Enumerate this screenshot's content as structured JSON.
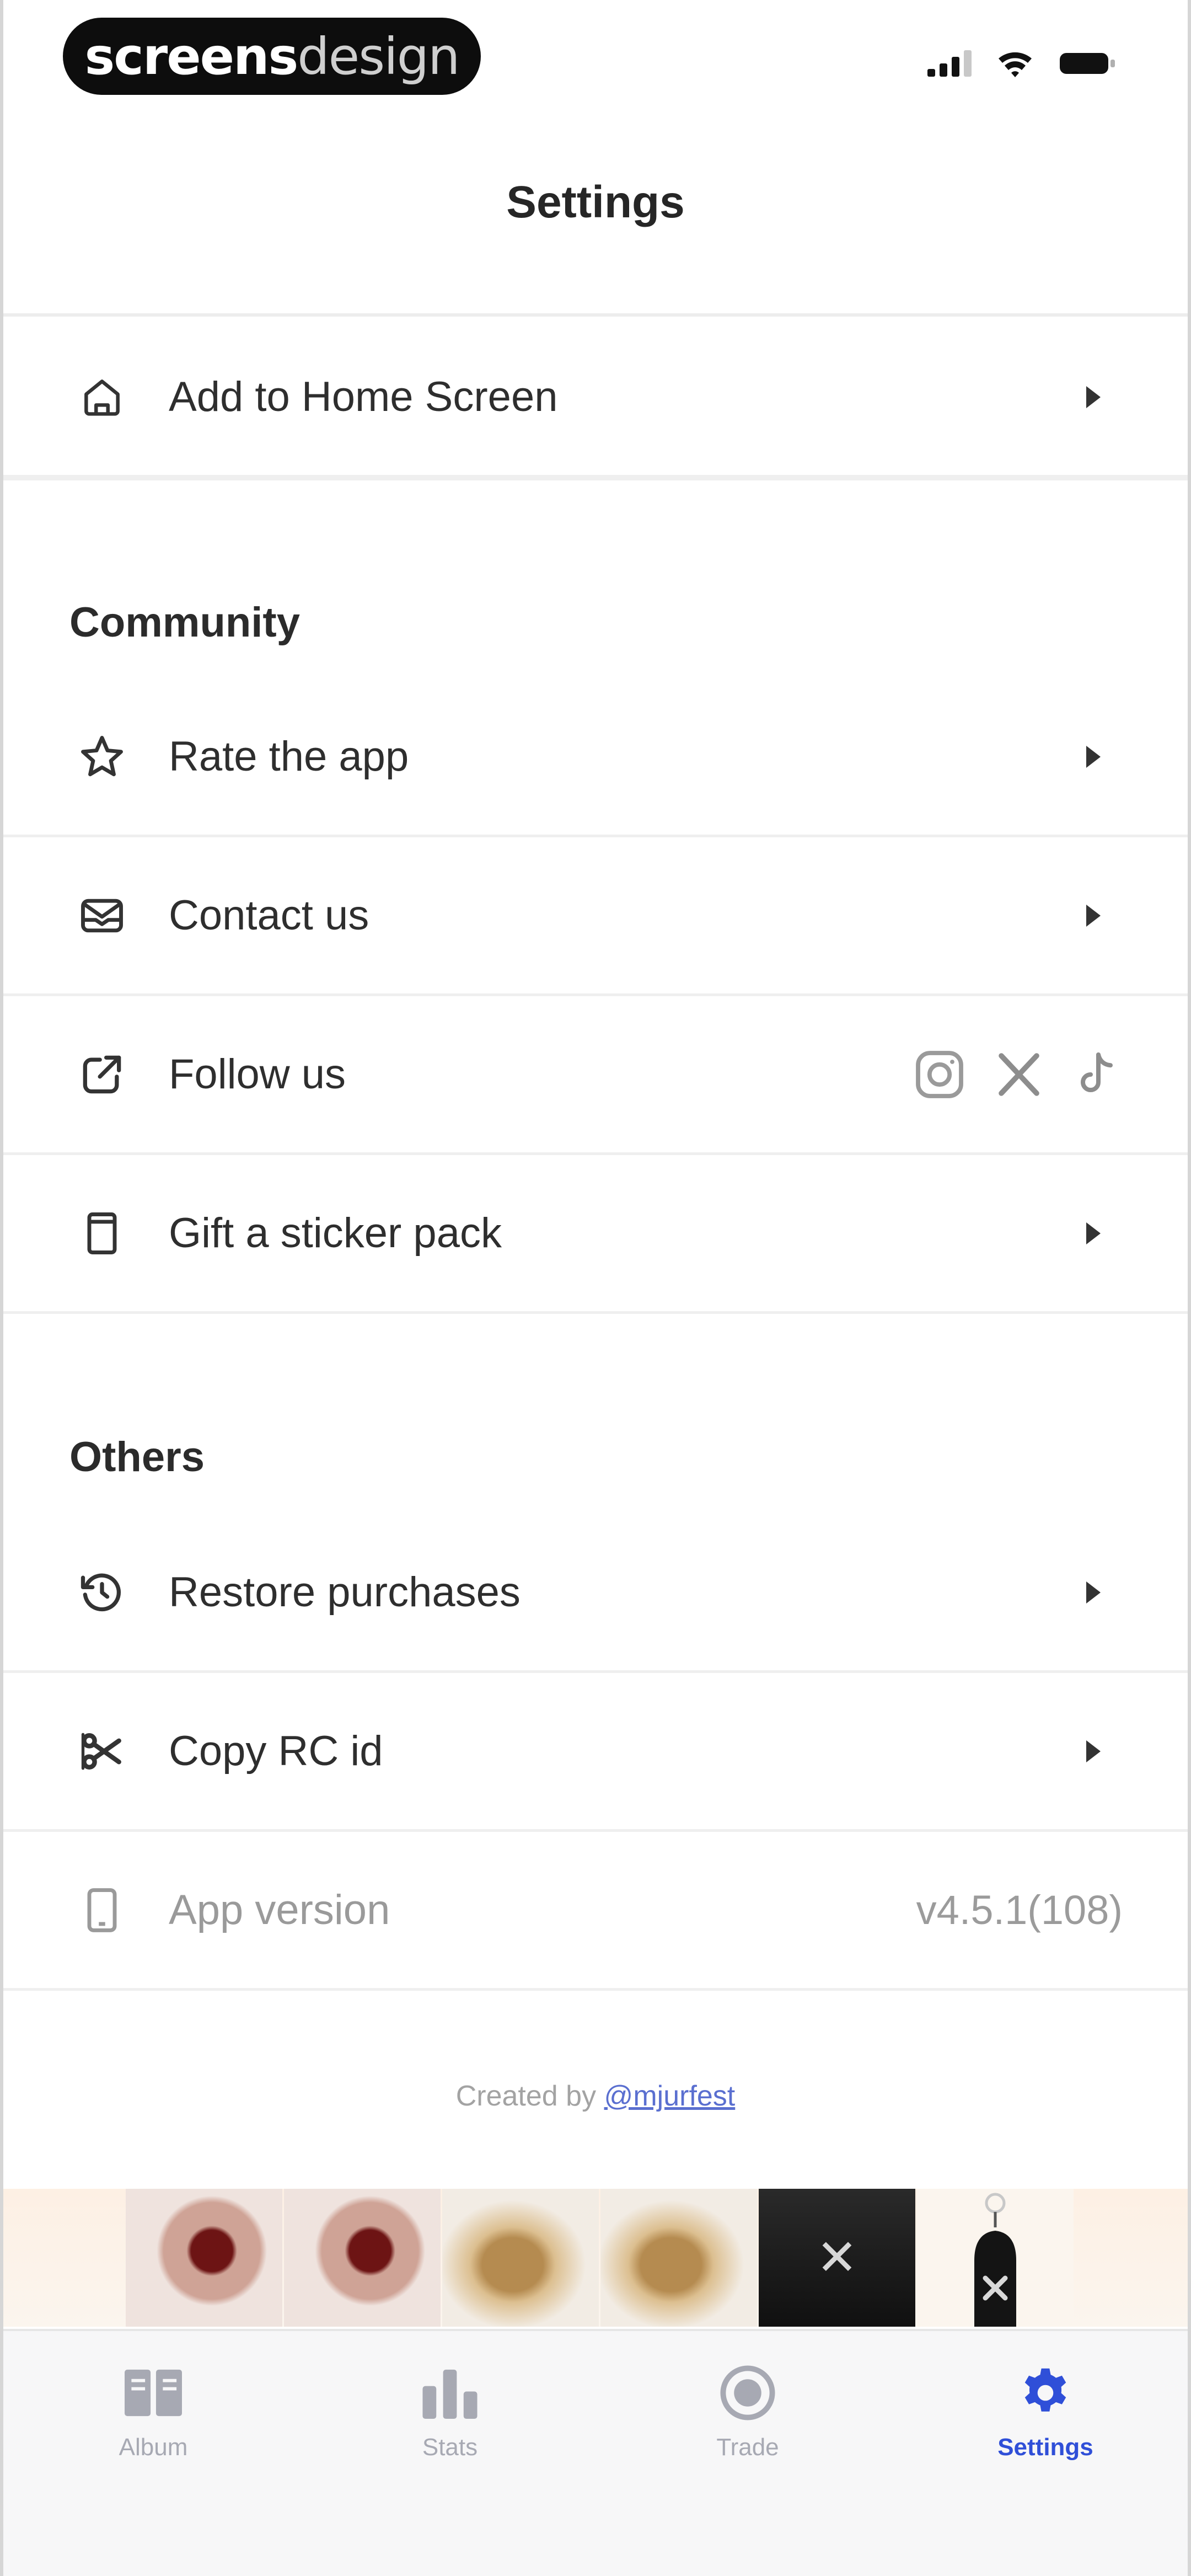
{
  "status_bar": {
    "brand_bold": "screens",
    "brand_light": "design"
  },
  "header": {
    "title": "Settings"
  },
  "rows": {
    "home": {
      "label": "Add to Home Screen",
      "icon": "home-icon"
    },
    "rate": {
      "label": "Rate the app",
      "icon": "star-icon"
    },
    "contact": {
      "label": "Contact us",
      "icon": "mail-icon"
    },
    "follow": {
      "label": "Follow us",
      "icon": "external-link-icon"
    },
    "gift": {
      "label": "Gift a sticker pack",
      "icon": "sticker-pack-icon"
    },
    "restore": {
      "label": "Restore purchases",
      "icon": "restore-icon"
    },
    "copy_rc": {
      "label": "Copy RC id",
      "icon": "scissors-icon"
    },
    "version": {
      "label": "App version",
      "value": "v4.5.1(108)",
      "icon": "phone-icon"
    }
  },
  "sections": {
    "community": "Community",
    "others": "Others"
  },
  "social": [
    "instagram-icon",
    "x-icon",
    "tiktok-icon"
  ],
  "footer": {
    "credit_prefix": "Created by",
    "credit_handle": "@mjurfest"
  },
  "tabs": [
    {
      "label": "Album",
      "icon": "album-icon",
      "active": false
    },
    {
      "label": "Stats",
      "icon": "bar-chart-icon",
      "active": false
    },
    {
      "label": "Trade",
      "icon": "trade-icon",
      "active": false
    },
    {
      "label": "Settings",
      "icon": "gear-icon",
      "active": true
    }
  ],
  "colors": {
    "accent": "#2f4fd8",
    "inactive_tab": "#a7a9b3",
    "text": "#2e2e2e",
    "muted": "#9a9a9a"
  }
}
